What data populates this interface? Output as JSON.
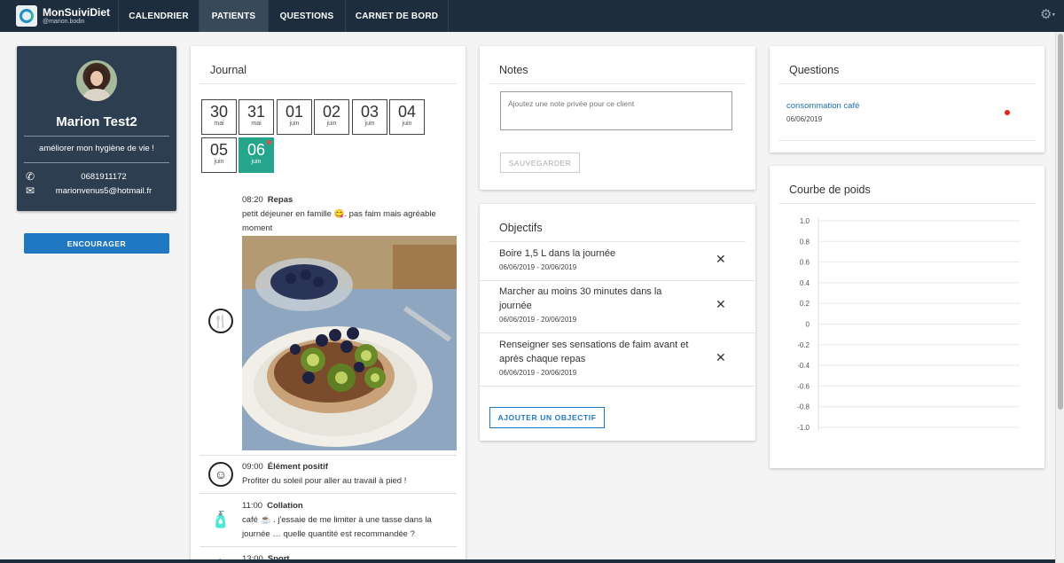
{
  "app": {
    "name": "MonSuiviDiet",
    "user": "@marion.bodin"
  },
  "nav": {
    "tabs": [
      {
        "label": "CALENDRIER"
      },
      {
        "label": "PATIENTS"
      },
      {
        "label": "QUESTIONS"
      },
      {
        "label": "CARNET DE BORD"
      }
    ]
  },
  "profile": {
    "name": "Marion Test2",
    "goal": "améliorer mon hygiène de vie !",
    "phone": "0681911172",
    "email": "marionvenus5@hotmail.fr",
    "encourage_label": "ENCOURAGER"
  },
  "journal": {
    "title": "Journal",
    "dates": [
      {
        "day": "30",
        "month": "mai"
      },
      {
        "day": "31",
        "month": "mai"
      },
      {
        "day": "01",
        "month": "juin"
      },
      {
        "day": "02",
        "month": "juin"
      },
      {
        "day": "03",
        "month": "juin"
      },
      {
        "day": "04",
        "month": "juin"
      },
      {
        "day": "05",
        "month": "juin"
      },
      {
        "day": "06",
        "month": "juin"
      }
    ],
    "entries": [
      {
        "time": "08:20",
        "type": "Repas",
        "text": "petit déjeuner en famille 😋. pas faim mais agréable moment",
        "icon": "restaurant-icon"
      },
      {
        "time": "09:00",
        "type": "Élément positif",
        "text": "Profiter du soleil pour aller au travail à pied !",
        "icon": "smiley-icon"
      },
      {
        "time": "11:00",
        "type": "Collation",
        "text": "café ☕ . j'essaie de me limiter à une tasse dans la journée … quelle quantité est recommandée ?",
        "icon": "bottle-icon"
      },
      {
        "time": "13:00",
        "type": "Sport",
        "text": "",
        "icon": "sport-icon"
      }
    ]
  },
  "notes": {
    "title": "Notes",
    "placeholder": "Ajoutez une note privée pour ce client",
    "save_label": "SAUVEGARDER"
  },
  "objectives": {
    "title": "Objectifs",
    "items": [
      {
        "title": "Boire 1,5 L dans la journée",
        "dates": "06/06/2019 - 20/06/2019"
      },
      {
        "title": "Marcher au moins 30 minutes dans la journée",
        "dates": "06/06/2019 - 20/06/2019"
      },
      {
        "title": "Renseigner ses sensations de faim avant et après chaque repas",
        "dates": "06/06/2019 - 20/06/2019"
      }
    ],
    "add_label": "AJOUTER UN OBJECTIF"
  },
  "questions": {
    "title": "Questions",
    "items": [
      {
        "label": "consommation café",
        "date": "06/06/2019"
      }
    ]
  },
  "weight": {
    "title": "Courbe de poids"
  },
  "chart_data": {
    "type": "line",
    "title": "Courbe de poids",
    "x": [],
    "series": [],
    "ylim": [
      -1.0,
      1.0
    ],
    "yticks": [
      "1.0",
      "0.8",
      "0.6",
      "0.4",
      "0.2",
      "0",
      "-0.2",
      "-0.4",
      "-0.6",
      "-0.8",
      "-1.0"
    ],
    "grid": true
  },
  "colors": {
    "topbar": "#1d2d3d",
    "accent": "#1f78c1",
    "active_date": "#25a58b",
    "card_dark": "#2c3e50"
  }
}
